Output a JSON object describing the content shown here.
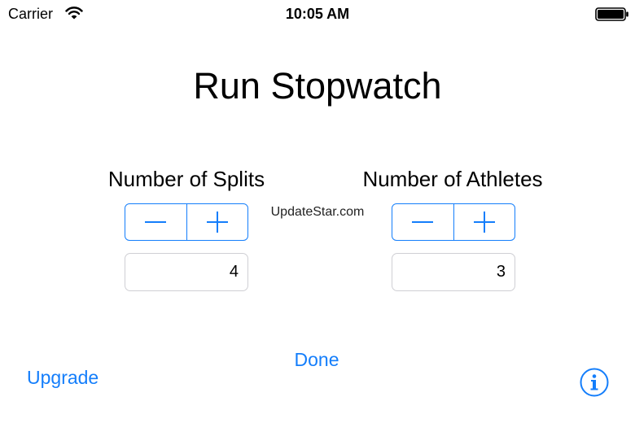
{
  "status_bar": {
    "carrier": "Carrier",
    "time": "10:05 AM",
    "wifi_icon": "wifi-icon",
    "battery_icon": "battery-full-icon"
  },
  "title": "Run Stopwatch",
  "splits": {
    "label": "Number of Splits",
    "value": "4",
    "decrement_icon": "minus-icon",
    "increment_icon": "plus-icon"
  },
  "athletes": {
    "label": "Number of Athletes",
    "value": "3",
    "decrement_icon": "minus-icon",
    "increment_icon": "plus-icon"
  },
  "watermark": "UpdateStar.com",
  "buttons": {
    "done": "Done",
    "upgrade": "Upgrade",
    "info_icon": "info-icon"
  },
  "colors": {
    "accent": "#147EFB",
    "field_border": "#cfcfd4",
    "text": "#000000",
    "background": "#ffffff"
  }
}
